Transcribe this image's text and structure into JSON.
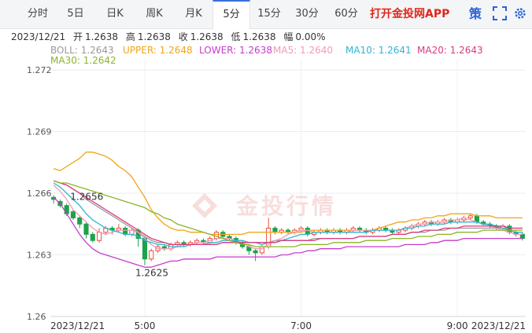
{
  "tabs": [
    "分时",
    "5日",
    "日K",
    "周K",
    "月K",
    "5分",
    "15分",
    "30分",
    "60分"
  ],
  "active_tab": "5分",
  "app_link": "打开金投网APP",
  "strategy_label": "策",
  "info": {
    "date": "2023/12/21",
    "open_label": "开",
    "open": "1.2638",
    "high_label": "高",
    "high": "1.2638",
    "close_label": "收",
    "close": "1.2638",
    "low_label": "低",
    "low": "1.2638",
    "amp_label": "幅",
    "amp": "0.00%"
  },
  "indicators": [
    {
      "label": "BOLL: 1.2643",
      "color": "#9a9a9a"
    },
    {
      "label": "UPPER: 1.2648",
      "color": "#f0a518"
    },
    {
      "label": "LOWER: 1.2638",
      "color": "#c43ec9"
    },
    {
      "label": "MA5: 1.2640",
      "color": "#f29ab8"
    },
    {
      "label": "MA10: 1.2641",
      "color": "#2fb5d4"
    },
    {
      "label": "MA20: 1.2643",
      "color": "#d93b7c"
    },
    {
      "label": "MA30: 1.2642",
      "color": "#8ab626"
    }
  ],
  "watermark": "金投行情",
  "chart_data": {
    "type": "candlestick",
    "ylim": [
      1.26,
      1.2725
    ],
    "y_ticks": [
      1.272,
      1.269,
      1.266,
      1.263,
      1.26
    ],
    "x_tick_labels": [
      "2023/12/21",
      "5:00",
      "7:00",
      "9:00",
      "2023/12/21"
    ],
    "x_tick_index": [
      0,
      14,
      38,
      62,
      72
    ],
    "annotations": [
      {
        "text": "1.2656",
        "index": 4,
        "value": 1.2656
      },
      {
        "text": "1.2625",
        "index": 14,
        "value": 1.2625
      }
    ],
    "candles": [
      [
        1.2658,
        1.2657,
        1.2659,
        1.2655
      ],
      [
        1.2656,
        1.2654,
        1.2657,
        1.2653
      ],
      [
        1.2654,
        1.265,
        1.2655,
        1.2649
      ],
      [
        1.2651,
        1.2648,
        1.2652,
        1.2647
      ],
      [
        1.2648,
        1.2645,
        1.2649,
        1.2643
      ],
      [
        1.2645,
        1.264,
        1.2646,
        1.2638
      ],
      [
        1.264,
        1.2637,
        1.2641,
        1.2636
      ],
      [
        1.2637,
        1.2641,
        1.2643,
        1.2636
      ],
      [
        1.2641,
        1.2643,
        1.2644,
        1.264
      ],
      [
        1.2643,
        1.2642,
        1.2644,
        1.264
      ],
      [
        1.2642,
        1.2643,
        1.2645,
        1.2641
      ],
      [
        1.2643,
        1.264,
        1.2644,
        1.2639
      ],
      [
        1.264,
        1.2642,
        1.2643,
        1.2639
      ],
      [
        1.2642,
        1.2638,
        1.2643,
        1.2634
      ],
      [
        1.2638,
        1.2628,
        1.2639,
        1.2625
      ],
      [
        1.2628,
        1.2632,
        1.2633,
        1.2627
      ],
      [
        1.2632,
        1.2634,
        1.2635,
        1.2631
      ],
      [
        1.2634,
        1.2633,
        1.2635,
        1.2632
      ],
      [
        1.2633,
        1.2635,
        1.2636,
        1.2632
      ],
      [
        1.2635,
        1.2636,
        1.2637,
        1.2634
      ],
      [
        1.2636,
        1.2635,
        1.2637,
        1.2634
      ],
      [
        1.2635,
        1.2636,
        1.2637,
        1.2634
      ],
      [
        1.2636,
        1.2637,
        1.2638,
        1.2635
      ],
      [
        1.2637,
        1.2636,
        1.2638,
        1.2635
      ],
      [
        1.2636,
        1.2638,
        1.2639,
        1.2635
      ],
      [
        1.2638,
        1.2641,
        1.2642,
        1.2637
      ],
      [
        1.2641,
        1.2639,
        1.2642,
        1.2638
      ],
      [
        1.2639,
        1.2638,
        1.264,
        1.2637
      ],
      [
        1.2638,
        1.2636,
        1.2639,
        1.2635
      ],
      [
        1.2636,
        1.2634,
        1.2637,
        1.2633
      ],
      [
        1.2634,
        1.2632,
        1.2635,
        1.263
      ],
      [
        1.2632,
        1.2631,
        1.2633,
        1.2627
      ],
      [
        1.2631,
        1.2634,
        1.2635,
        1.263
      ],
      [
        1.2634,
        1.2643,
        1.2648,
        1.2633
      ],
      [
        1.2643,
        1.2641,
        1.2644,
        1.264
      ],
      [
        1.2641,
        1.2642,
        1.2643,
        1.264
      ],
      [
        1.2642,
        1.2641,
        1.2643,
        1.264
      ],
      [
        1.2641,
        1.2642,
        1.2643,
        1.264
      ],
      [
        1.2642,
        1.2643,
        1.2644,
        1.2641
      ],
      [
        1.2643,
        1.264,
        1.2644,
        1.2639
      ],
      [
        1.264,
        1.2641,
        1.2642,
        1.2639
      ],
      [
        1.2641,
        1.2642,
        1.2643,
        1.264
      ],
      [
        1.2642,
        1.2641,
        1.2643,
        1.264
      ],
      [
        1.2641,
        1.2642,
        1.2643,
        1.264
      ],
      [
        1.2642,
        1.2641,
        1.2643,
        1.264
      ],
      [
        1.2641,
        1.2642,
        1.2643,
        1.264
      ],
      [
        1.2642,
        1.2643,
        1.2644,
        1.2641
      ],
      [
        1.2643,
        1.2642,
        1.2644,
        1.2641
      ],
      [
        1.2642,
        1.2641,
        1.2643,
        1.264
      ],
      [
        1.2641,
        1.2642,
        1.2643,
        1.264
      ],
      [
        1.2642,
        1.2643,
        1.2644,
        1.2641
      ],
      [
        1.2643,
        1.2642,
        1.2644,
        1.2641
      ],
      [
        1.2642,
        1.2641,
        1.2643,
        1.264
      ],
      [
        1.2641,
        1.2642,
        1.2643,
        1.264
      ],
      [
        1.2642,
        1.2643,
        1.2644,
        1.2641
      ],
      [
        1.2643,
        1.2644,
        1.2645,
        1.2642
      ],
      [
        1.2644,
        1.2645,
        1.2646,
        1.2643
      ],
      [
        1.2645,
        1.2646,
        1.2647,
        1.2644
      ],
      [
        1.2646,
        1.2645,
        1.2647,
        1.2644
      ],
      [
        1.2645,
        1.2646,
        1.2647,
        1.2644
      ],
      [
        1.2646,
        1.2647,
        1.2648,
        1.2645
      ],
      [
        1.2647,
        1.2646,
        1.2648,
        1.2645
      ],
      [
        1.2646,
        1.2647,
        1.2648,
        1.2645
      ],
      [
        1.2647,
        1.2648,
        1.2649,
        1.2646
      ],
      [
        1.2648,
        1.2649,
        1.265,
        1.2647
      ],
      [
        1.2649,
        1.2646,
        1.265,
        1.2645
      ],
      [
        1.2646,
        1.2645,
        1.2647,
        1.2644
      ],
      [
        1.2645,
        1.2644,
        1.2646,
        1.2643
      ],
      [
        1.2644,
        1.2643,
        1.2645,
        1.2642
      ],
      [
        1.2643,
        1.2644,
        1.2645,
        1.2642
      ],
      [
        1.2644,
        1.2641,
        1.2645,
        1.264
      ],
      [
        1.2641,
        1.264,
        1.2642,
        1.2639
      ],
      [
        1.264,
        1.2638,
        1.2641,
        1.2637
      ]
    ],
    "series": [
      {
        "name": "UPPER",
        "color": "#f0a518",
        "values": [
          1.2672,
          1.2671,
          1.2673,
          1.2675,
          1.2677,
          1.268,
          1.268,
          1.2679,
          1.2678,
          1.2676,
          1.2673,
          1.2671,
          1.2668,
          1.2663,
          1.2658,
          1.2652,
          1.2648,
          1.2645,
          1.2643,
          1.2642,
          1.2642,
          1.2641,
          1.2641,
          1.2641,
          1.264,
          1.264,
          1.264,
          1.264,
          1.264,
          1.264,
          1.2641,
          1.2641,
          1.2641,
          1.2641,
          1.2641,
          1.2641,
          1.2641,
          1.2641,
          1.2641,
          1.2642,
          1.2642,
          1.2642,
          1.2642,
          1.2642,
          1.2642,
          1.2642,
          1.2642,
          1.2642,
          1.2642,
          1.2642,
          1.2643,
          1.2644,
          1.2645,
          1.2646,
          1.2646,
          1.2647,
          1.2647,
          1.2648,
          1.2648,
          1.2649,
          1.2649,
          1.265,
          1.265,
          1.265,
          1.265,
          1.2649,
          1.2649,
          1.2649,
          1.2648,
          1.2648,
          1.2648,
          1.2648,
          1.2648
        ]
      },
      {
        "name": "BOLL",
        "color": "#9a9a9a",
        "values": [
          1.2666,
          1.2665,
          1.2664,
          1.2662,
          1.266,
          1.2657,
          1.2655,
          1.2653,
          1.2651,
          1.2649,
          1.2647,
          1.2645,
          1.2643,
          1.2641,
          1.2639,
          1.2637,
          1.2636,
          1.2636,
          1.2635,
          1.2635,
          1.2635,
          1.2635,
          1.2635,
          1.2635,
          1.2635,
          1.2635,
          1.2636,
          1.2636,
          1.2636,
          1.2636,
          1.2636,
          1.2636,
          1.2636,
          1.2636,
          1.2637,
          1.2637,
          1.2637,
          1.2637,
          1.2637,
          1.2637,
          1.2638,
          1.2638,
          1.2638,
          1.2638,
          1.2638,
          1.2638,
          1.2638,
          1.2639,
          1.2639,
          1.2639,
          1.2639,
          1.2639,
          1.264,
          1.264,
          1.264,
          1.2641,
          1.2641,
          1.2641,
          1.2642,
          1.2642,
          1.2642,
          1.2643,
          1.2643,
          1.2643,
          1.2643,
          1.2643,
          1.2643,
          1.2643,
          1.2643,
          1.2643,
          1.2643,
          1.2643,
          1.2643
        ]
      },
      {
        "name": "LOWER",
        "color": "#c43ec9",
        "values": [
          1.2658,
          1.2655,
          1.265,
          1.2645,
          1.264,
          1.2636,
          1.2633,
          1.2631,
          1.263,
          1.2629,
          1.2628,
          1.2627,
          1.2626,
          1.2625,
          1.2624,
          1.2624,
          1.2625,
          1.2626,
          1.2627,
          1.2627,
          1.2628,
          1.2628,
          1.2628,
          1.2628,
          1.2628,
          1.2629,
          1.2629,
          1.2629,
          1.2629,
          1.2629,
          1.2629,
          1.2629,
          1.2629,
          1.2629,
          1.2629,
          1.263,
          1.263,
          1.2631,
          1.2631,
          1.2632,
          1.2632,
          1.2633,
          1.2633,
          1.2633,
          1.2633,
          1.2634,
          1.2634,
          1.2634,
          1.2634,
          1.2634,
          1.2634,
          1.2634,
          1.2634,
          1.2634,
          1.2635,
          1.2635,
          1.2635,
          1.2635,
          1.2636,
          1.2636,
          1.2637,
          1.2637,
          1.2637,
          1.2638,
          1.2638,
          1.2638,
          1.2638,
          1.2638,
          1.2638,
          1.2638,
          1.2638,
          1.2638,
          1.2638
        ]
      },
      {
        "name": "MA5",
        "color": "#f29ab8",
        "values": [
          1.2664,
          1.2661,
          1.2657,
          1.2652,
          1.2649,
          1.2646,
          1.2643,
          1.2641,
          1.264,
          1.2641,
          1.2642,
          1.2642,
          1.2642,
          1.2641,
          1.2638,
          1.2635,
          1.2633,
          1.2633,
          1.2633,
          1.2634,
          1.2635,
          1.2635,
          1.2636,
          1.2636,
          1.2637,
          1.2638,
          1.2638,
          1.2638,
          1.2637,
          1.2636,
          1.2634,
          1.2633,
          1.2633,
          1.2635,
          1.2637,
          1.2638,
          1.264,
          1.2641,
          1.2642,
          1.2642,
          1.2641,
          1.2641,
          1.2641,
          1.2641,
          1.2641,
          1.2641,
          1.2642,
          1.2642,
          1.2642,
          1.2642,
          1.2642,
          1.2642,
          1.2642,
          1.2642,
          1.2643,
          1.2644,
          1.2645,
          1.2645,
          1.2646,
          1.2646,
          1.2646,
          1.2647,
          1.2647,
          1.2648,
          1.2647,
          1.2646,
          1.2645,
          1.2644,
          1.2643,
          1.2642,
          1.2641,
          1.264,
          1.264
        ]
      },
      {
        "name": "MA10",
        "color": "#2fb5d4",
        "values": [
          1.2665,
          1.2663,
          1.266,
          1.2657,
          1.2654,
          1.265,
          1.2647,
          1.2645,
          1.2643,
          1.2642,
          1.2641,
          1.264,
          1.264,
          1.2639,
          1.2637,
          1.2636,
          1.2635,
          1.2635,
          1.2634,
          1.2634,
          1.2634,
          1.2635,
          1.2635,
          1.2635,
          1.2636,
          1.2636,
          1.2637,
          1.2637,
          1.2637,
          1.2637,
          1.2636,
          1.2636,
          1.2635,
          1.2636,
          1.2636,
          1.2637,
          1.2638,
          1.2639,
          1.264,
          1.264,
          1.2641,
          1.2641,
          1.2641,
          1.2641,
          1.2641,
          1.2641,
          1.2641,
          1.2641,
          1.2641,
          1.2642,
          1.2642,
          1.2642,
          1.2642,
          1.2642,
          1.2643,
          1.2643,
          1.2644,
          1.2644,
          1.2645,
          1.2645,
          1.2645,
          1.2646,
          1.2646,
          1.2646,
          1.2646,
          1.2646,
          1.2645,
          1.2645,
          1.2644,
          1.2643,
          1.2642,
          1.2641,
          1.2641
        ]
      },
      {
        "name": "MA20",
        "color": "#d93b7c",
        "values": [
          1.2666,
          1.2665,
          1.2664,
          1.2662,
          1.266,
          1.2658,
          1.2656,
          1.2654,
          1.2652,
          1.265,
          1.2648,
          1.2646,
          1.2644,
          1.2642,
          1.264,
          1.2638,
          1.2637,
          1.2636,
          1.2635,
          1.2635,
          1.2635,
          1.2635,
          1.2635,
          1.2635,
          1.2635,
          1.2635,
          1.2636,
          1.2636,
          1.2636,
          1.2636,
          1.2636,
          1.2636,
          1.2636,
          1.2636,
          1.2636,
          1.2637,
          1.2637,
          1.2637,
          1.2637,
          1.2637,
          1.2637,
          1.2638,
          1.2638,
          1.2638,
          1.2638,
          1.2638,
          1.2638,
          1.2639,
          1.2639,
          1.2639,
          1.2639,
          1.2639,
          1.264,
          1.264,
          1.264,
          1.2641,
          1.2641,
          1.2642,
          1.2642,
          1.2642,
          1.2643,
          1.2643,
          1.2643,
          1.2644,
          1.2644,
          1.2644,
          1.2644,
          1.2644,
          1.2644,
          1.2644,
          1.2643,
          1.2643,
          1.2643
        ]
      },
      {
        "name": "MA30",
        "color": "#8ab626",
        "values": [
          1.2666,
          1.2665,
          1.2665,
          1.2664,
          1.2663,
          1.2662,
          1.2661,
          1.266,
          1.2659,
          1.2658,
          1.2657,
          1.2656,
          1.2655,
          1.2654,
          1.2653,
          1.2651,
          1.265,
          1.2648,
          1.2647,
          1.2645,
          1.2644,
          1.2643,
          1.2642,
          1.2641,
          1.264,
          1.2639,
          1.2638,
          1.2637,
          1.2636,
          1.2635,
          1.2635,
          1.2634,
          1.2634,
          1.2634,
          1.2634,
          1.2634,
          1.2634,
          1.2634,
          1.2635,
          1.2635,
          1.2635,
          1.2635,
          1.2635,
          1.2636,
          1.2636,
          1.2636,
          1.2636,
          1.2636,
          1.2637,
          1.2637,
          1.2637,
          1.2637,
          1.2638,
          1.2638,
          1.2638,
          1.2638,
          1.2639,
          1.2639,
          1.2639,
          1.264,
          1.264,
          1.264,
          1.2641,
          1.2641,
          1.2641,
          1.2641,
          1.2642,
          1.2642,
          1.2642,
          1.2642,
          1.2642,
          1.2642,
          1.2642
        ]
      }
    ]
  }
}
